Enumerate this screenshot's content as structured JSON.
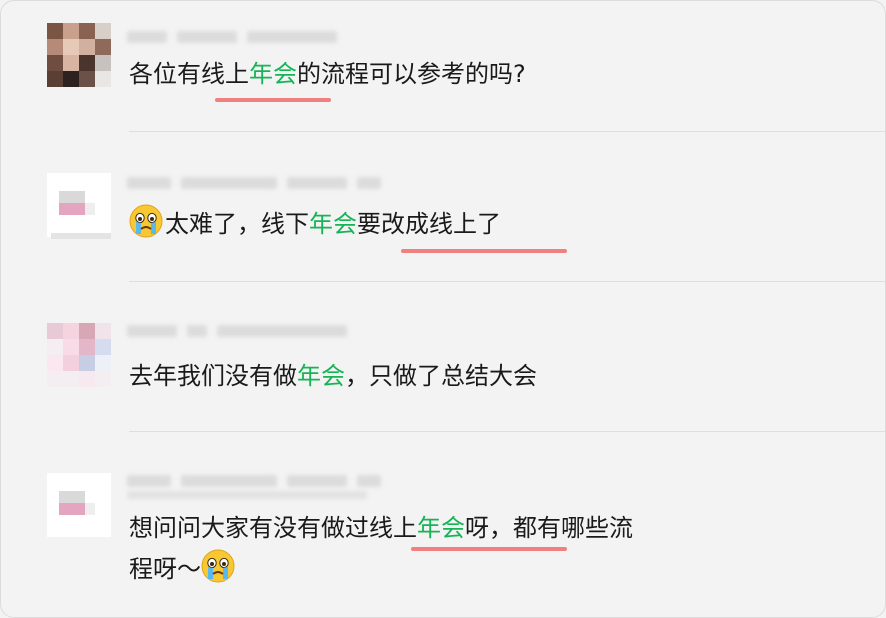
{
  "messages": [
    {
      "text_parts": [
        "各位有线上",
        "年会",
        "的流程可以参考的吗?"
      ]
    },
    {
      "emoji": "crying-face-emoji",
      "text_parts": [
        "太难了，线下",
        "年会",
        "要改成线上了"
      ]
    },
    {
      "text_parts": [
        "去年我们没有做",
        "年会",
        "，只做了总结大会"
      ]
    },
    {
      "line1_parts": [
        "想问问大家有没有做过线上",
        "年会",
        "呀，都有哪些流"
      ],
      "line2": "程呀～",
      "emoji": "crying-face-emoji"
    }
  ],
  "colors": {
    "highlight": "#16b457",
    "underline": "#f07f7f",
    "background": "#f3f3f3"
  }
}
